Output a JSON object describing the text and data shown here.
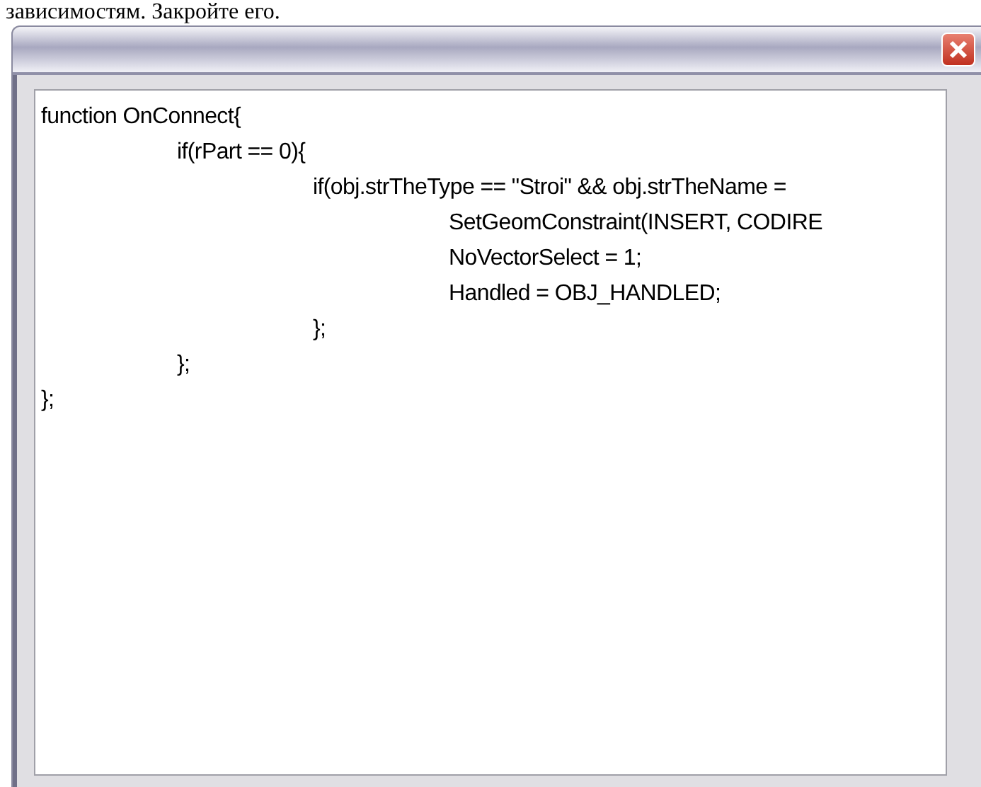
{
  "page_text": "зависимостям. Закройте его.",
  "editor": {
    "lines": [
      {
        "text": "function OnConnect{",
        "children": [
          {
            "text": "if(rPart == 0){",
            "children": [
              {
                "text": "if(obj.strTheType == \"Stroi\" && obj.strTheName =",
                "children": [
                  {
                    "text": "SetGeomConstraint(INSERT, CODIRE"
                  },
                  {
                    "text": "NoVectorSelect = 1;"
                  },
                  {
                    "text": "Handled = OBJ_HANDLED;"
                  }
                ]
              },
              {
                "text": "};"
              }
            ]
          },
          {
            "text": "};"
          }
        ]
      },
      {
        "text": "};"
      }
    ]
  }
}
